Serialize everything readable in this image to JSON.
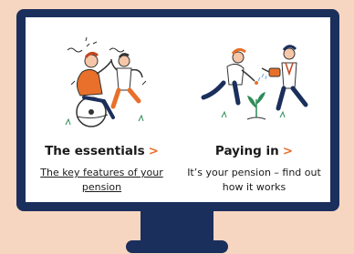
{
  "cards": [
    {
      "title": "The essentials",
      "chevron": ">",
      "description": "The key features of your pension",
      "is_link": true,
      "illustration": "people-celebrating-illustration"
    },
    {
      "title": "Paying in",
      "chevron": ">",
      "description": "It’s your pension – find out how it works",
      "is_link": false,
      "illustration": "people-watering-plant-illustration"
    }
  ],
  "colors": {
    "background": "#f7d6c1",
    "monitor": "#1b2f5c",
    "accent": "#e8702a"
  }
}
